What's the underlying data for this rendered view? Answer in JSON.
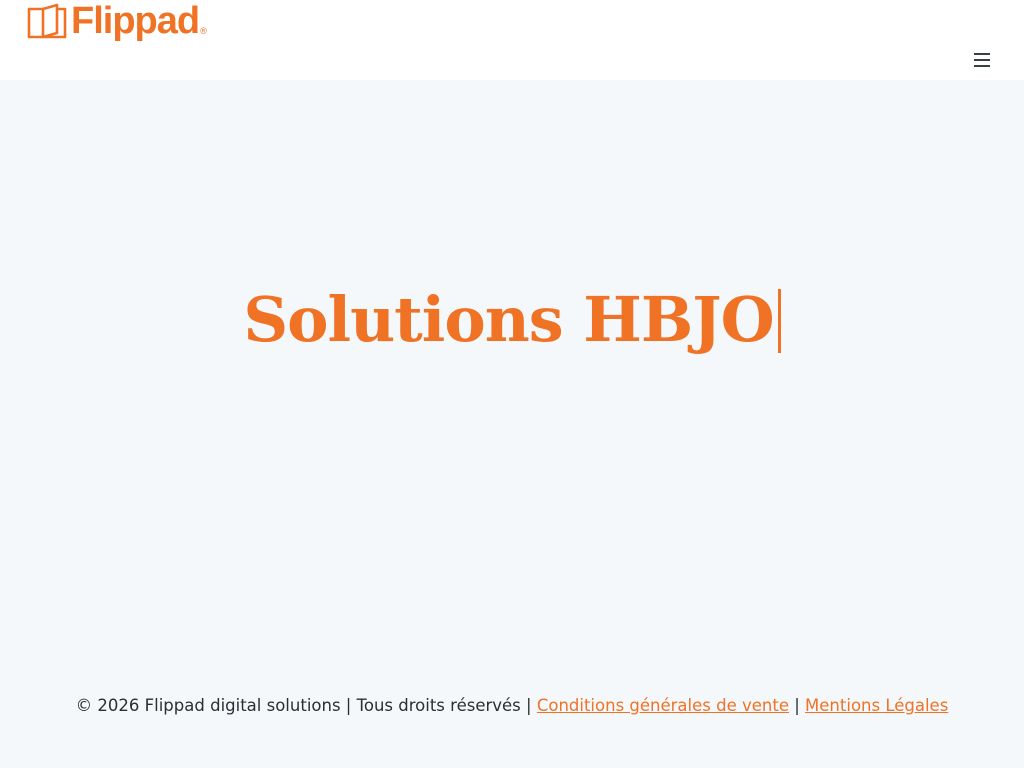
{
  "header": {
    "logo_text": "Flippad",
    "logo_mark": "®",
    "menu_icon": "hamburger-menu-icon"
  },
  "hero": {
    "title": "Solutions HBJO"
  },
  "footer": {
    "copyright": "© 2026 Flippad digital solutions | Tous droits réservés |",
    "cgv_link": "Conditions générales de vente",
    "separator": "|",
    "legal_link": "Mentions Légales"
  },
  "colors": {
    "accent": "#f07225",
    "background": "#f5f8fb",
    "header_bg": "#ffffff",
    "text": "#2b2f33"
  }
}
